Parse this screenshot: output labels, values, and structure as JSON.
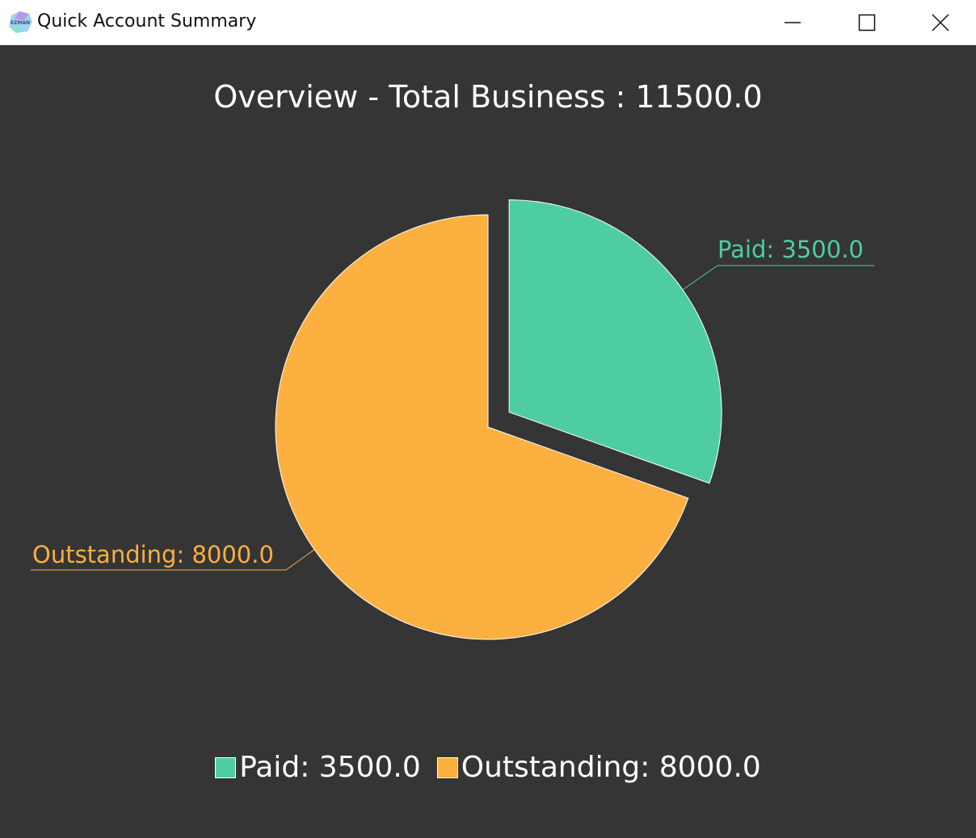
{
  "window": {
    "title": "Quick Account Summary",
    "icon_name": "ezman-app-icon",
    "icon_text": "EZMAN",
    "controls": [
      "minimize-icon",
      "maximize-icon",
      "close-icon"
    ]
  },
  "colors": {
    "background": "#353535",
    "paid": "#4ecda3",
    "outstanding": "#fbb040",
    "title_text": "#ffffff"
  },
  "chart_data": {
    "type": "pie",
    "title": "Overview - Total Business : 11500.0",
    "categories": [
      "Paid",
      "Outstanding"
    ],
    "values": [
      3500.0,
      8000.0
    ],
    "labels": [
      "Paid: 3500.0",
      "Outstanding: 8000.0"
    ],
    "exploded": [
      "Paid"
    ],
    "legend": {
      "placement": "bottom",
      "entries": [
        "Paid: 3500.0",
        "Outstanding: 8000.0"
      ]
    }
  }
}
